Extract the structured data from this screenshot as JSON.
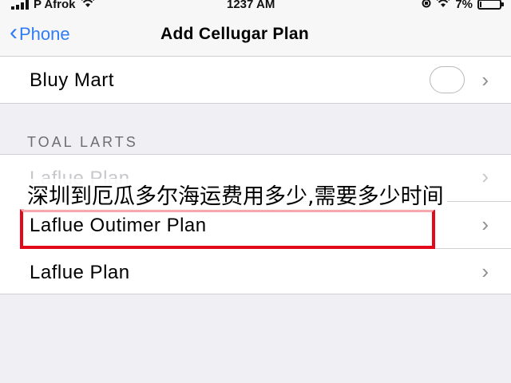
{
  "status_bar": {
    "carrier": "P Afrok",
    "time": "1237 AM",
    "battery_text": "7%",
    "battery_level_percent": 7,
    "signal_icon": "signal-bars-icon",
    "wifi_icon": "wifi-icon"
  },
  "nav": {
    "back_label": "Phone",
    "title": "Add Cellugar Plan"
  },
  "top_row": {
    "label": "Bluy Mart"
  },
  "section": {
    "header": "TOAL LARTS",
    "items": [
      {
        "label": "Laflue Plan"
      },
      {
        "label": "Laflue Outimer Plan"
      },
      {
        "label": "Laflue Plan"
      }
    ]
  },
  "overlay": {
    "caption": "深圳到厄瓜多尔海运费用多少,需要多少时间"
  },
  "colors": {
    "accent": "#2f7cf6",
    "highlight": "#e1091a",
    "background": "#efeff4"
  }
}
